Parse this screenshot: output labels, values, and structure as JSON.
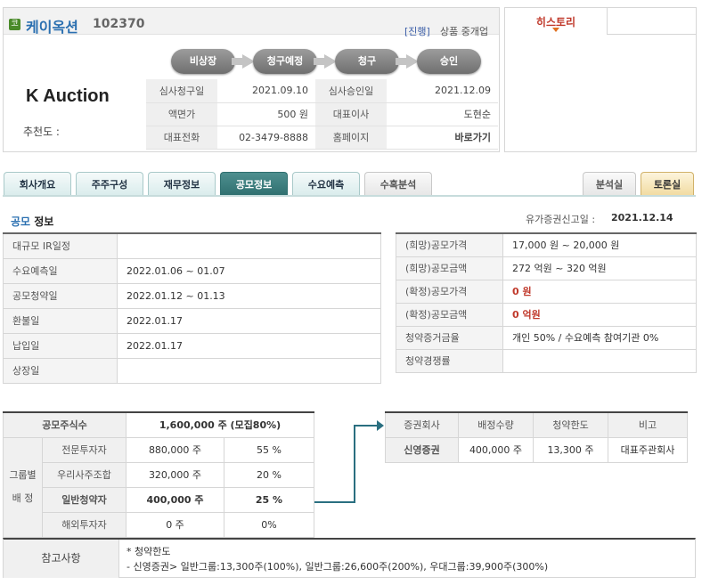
{
  "company": {
    "icon_label": "코",
    "name": "케이옥션",
    "code": "102370",
    "status_tag": "[진행]",
    "status_text": "상품 중개업",
    "logo_text": "K Auction",
    "recommend_label": "추천도 :"
  },
  "steps": [
    "비상장",
    "청구예정",
    "청구",
    "승인"
  ],
  "info": {
    "rows": [
      {
        "l1": "심사청구일",
        "v1": "2021.09.10",
        "l2": "심사승인일",
        "v2": "2021.12.09"
      },
      {
        "l1": "액면가",
        "v1": "500 원",
        "l2": "대표이사",
        "v2": "도현순"
      },
      {
        "l1": "대표전화",
        "v1": "02-3479-8888",
        "l2": "홈페이지",
        "v2": "바로가기"
      }
    ]
  },
  "history": {
    "tab": "히스토리"
  },
  "tabs": [
    {
      "label": "회사개요"
    },
    {
      "label": "주주구성"
    },
    {
      "label": "재무정보"
    },
    {
      "label": "공모정보"
    },
    {
      "label": "수요예측"
    },
    {
      "label": "수혹분석"
    },
    {
      "label": "분석실"
    },
    {
      "label": "토론실"
    }
  ],
  "section": {
    "title_a": "공모",
    "title_b": " 정보",
    "filing_label": "유가증권신고일 :",
    "filing_date": "2021.12.14"
  },
  "left_table": [
    {
      "label": "대규모 IR일정",
      "value": ""
    },
    {
      "label": "수요예측일",
      "value": "2022.01.06 ~ 01.07"
    },
    {
      "label": "공모청약일",
      "value": "2022.01.12 ~ 01.13"
    },
    {
      "label": "환불일",
      "value": "2022.01.17"
    },
    {
      "label": "납입일",
      "value": "2022.01.17"
    },
    {
      "label": "상장일",
      "value": ""
    }
  ],
  "right_table": [
    {
      "label": "(희망)공모가격",
      "value": "17,000 원 ~ 20,000 원"
    },
    {
      "label": "(희망)공모금액",
      "value": "272 억원   ~ 320 억원"
    },
    {
      "label": "(확정)공모가격",
      "value": "0 원"
    },
    {
      "label": "(확정)공모금액",
      "value": "0 억원"
    },
    {
      "label": "청약증거금율",
      "value": "개인 50% / 수요예측 참여기관 0%"
    },
    {
      "label": "청약경쟁률",
      "value": ""
    }
  ],
  "allocation": {
    "total_label": "공모주식수",
    "total_value": "1,600,000  주 (모집80%)",
    "group_label_1": "그룹별",
    "group_label_2": "배  정",
    "rows": [
      {
        "label": "전문투자자",
        "shares": "880,000 주",
        "pct": "55 %"
      },
      {
        "label": "우리사주조합",
        "shares": "320,000 주",
        "pct": "20 %"
      },
      {
        "label": "일반청약자",
        "shares": "400,000  주",
        "pct": "25 %"
      },
      {
        "label": "해외투자자",
        "shares": "0 주",
        "pct": "0%"
      }
    ]
  },
  "securities": {
    "headers": [
      "증권회사",
      "배정수량",
      "청약한도",
      "비고"
    ],
    "row": [
      "신영증권",
      "400,000 주",
      "13,300 주",
      "대표주관회사"
    ]
  },
  "reference": {
    "label": "참고사항",
    "line1": "* 청약한도",
    "line2": "- 신영증권> 일반그룹:13,300주(100%), 일반그룹:26,600주(200%), 우대그룹:39,900주(300%)"
  }
}
